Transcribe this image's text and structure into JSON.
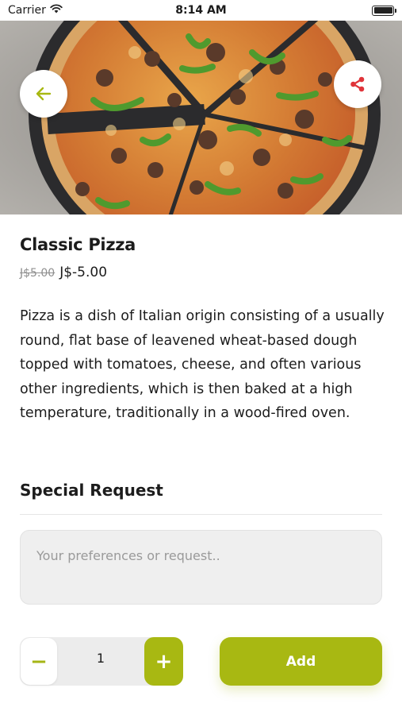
{
  "status_bar": {
    "carrier": "Carrier",
    "time": "8:14 AM",
    "wifi_icon": "wifi-icon",
    "battery_icon": "battery-icon"
  },
  "hero": {
    "image": "pizza-photo",
    "back_icon": "arrow-left-icon",
    "share_icon": "share-icon"
  },
  "product": {
    "name": "Classic Pizza",
    "old_price": "J$5.00",
    "price": "J$-5.00",
    "description": "Pizza is a dish of Italian origin consisting of a usually round, flat base of leavened wheat-based dough topped with tomatoes, cheese, and often various other ingredients, which is then baked at a high temperature, traditionally in a wood-fired oven."
  },
  "special_request": {
    "heading": "Special Request",
    "placeholder": "Your preferences or request..",
    "value": ""
  },
  "order": {
    "minus_label": "−",
    "quantity": "1",
    "plus_label": "+",
    "add_label": "Add"
  },
  "colors": {
    "accent": "#a8b812",
    "share_icon": "#e0343a",
    "text": "#1c1c1c"
  }
}
